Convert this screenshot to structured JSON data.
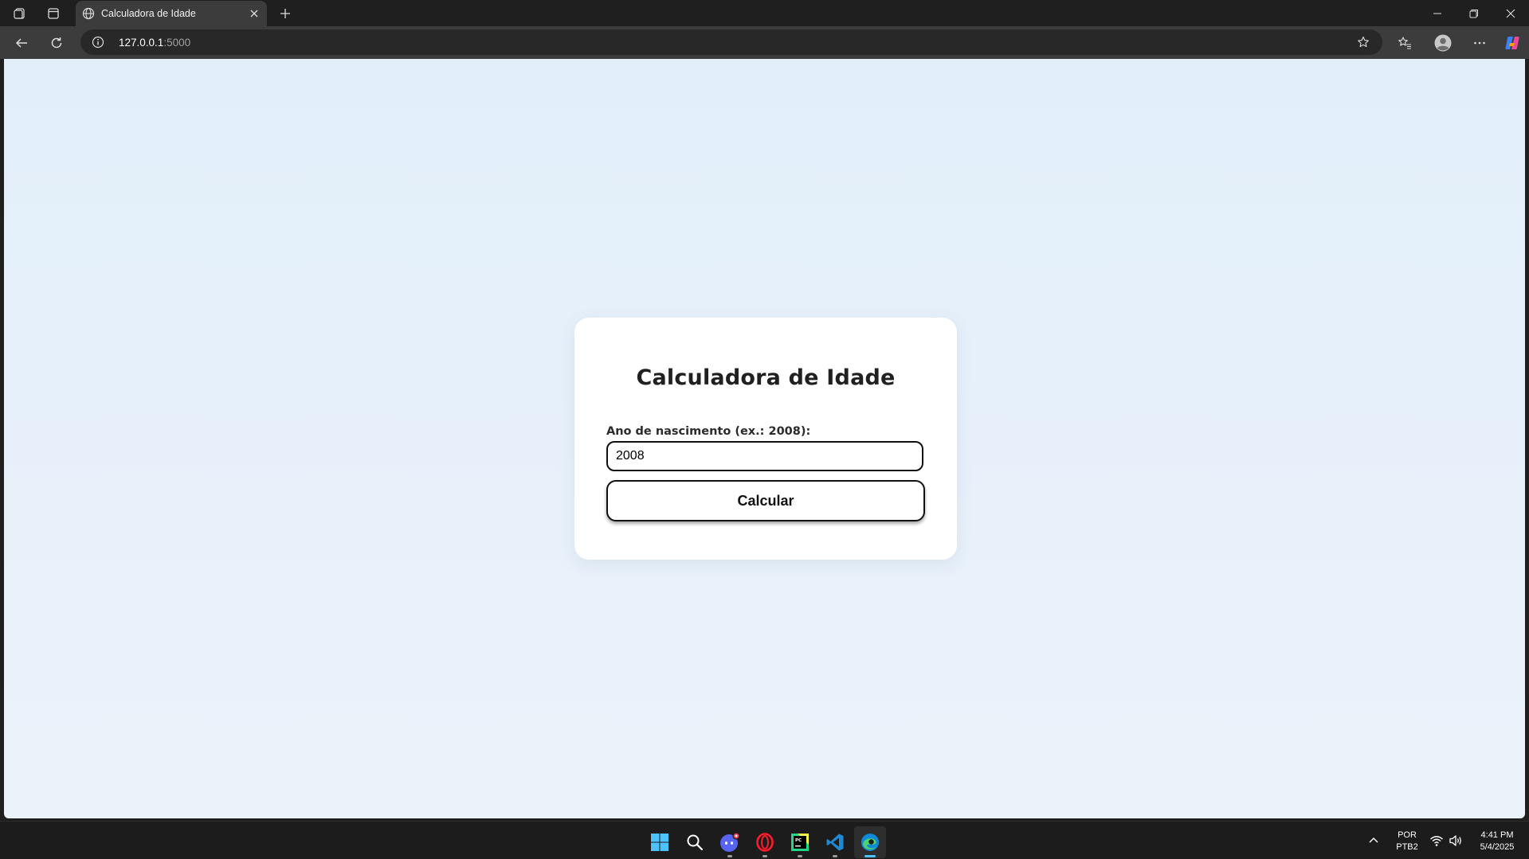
{
  "browser": {
    "tab": {
      "title": "Calculadora de Idade"
    },
    "address": {
      "host": "127.0.0.1",
      "port": ":5000"
    }
  },
  "page": {
    "title": "Calculadora de Idade",
    "label": "Ano de nascimento (ex.: 2008):",
    "input_value": "2008",
    "button_label": "Calcular"
  },
  "taskbar": {
    "apps": [
      "start",
      "search",
      "discord",
      "opera",
      "pycharm",
      "vscode",
      "edge"
    ],
    "language_top": "POR",
    "language_bottom": "PTB2",
    "time": "4:41 PM",
    "date": "5/4/2025"
  },
  "colors": {
    "page_bg": "#e4effa",
    "card_bg": "#ffffff",
    "accent_edge": "#4cc2ff"
  }
}
